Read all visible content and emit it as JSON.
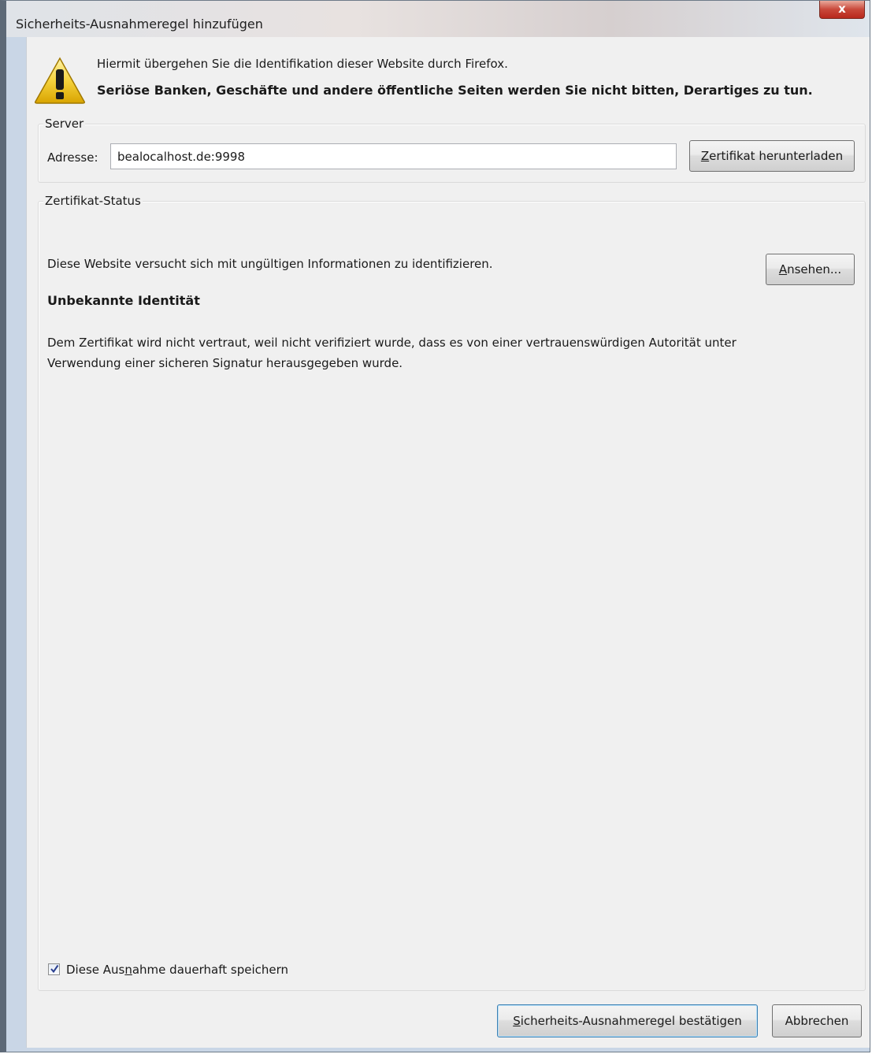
{
  "window": {
    "title": "Sicherheits-Ausnahmeregel hinzufügen",
    "close_glyph": "x"
  },
  "warning": {
    "icon": "warning-triangle-icon",
    "line1": "Hiermit übergehen Sie die Identifikation dieser Website durch Firefox.",
    "line2": "Seriöse Banken, Geschäfte und andere öffentliche Seiten werden Sie nicht bitten, Derartiges zu tun."
  },
  "server": {
    "legend": "Server",
    "address_label": "Adresse:",
    "address_value": "bealocalhost.de:9998",
    "download_button": {
      "accel": "Z",
      "rest": "ertifikat herunterladen"
    }
  },
  "status": {
    "legend": "Zertifikat-Status",
    "message": "Diese Website versucht sich mit ungültigen Informationen zu identifizieren.",
    "view_button": {
      "accel": "A",
      "rest": "nsehen..."
    },
    "heading": "Unbekannte Identität",
    "description": "Dem Zertifikat wird nicht vertraut, weil nicht verifiziert wurde, dass es von einer vertrauenswürdigen Autorität unter Verwendung einer sicheren Signatur herausgegeben wurde."
  },
  "persist": {
    "checked": true,
    "label_pre": "Diese Aus",
    "label_accel": "n",
    "label_post": "ahme dauerhaft speichern"
  },
  "buttons": {
    "confirm": {
      "accel": "S",
      "rest": "icherheits-Ausnahmeregel bestätigen"
    },
    "cancel": "Abbrechen"
  }
}
